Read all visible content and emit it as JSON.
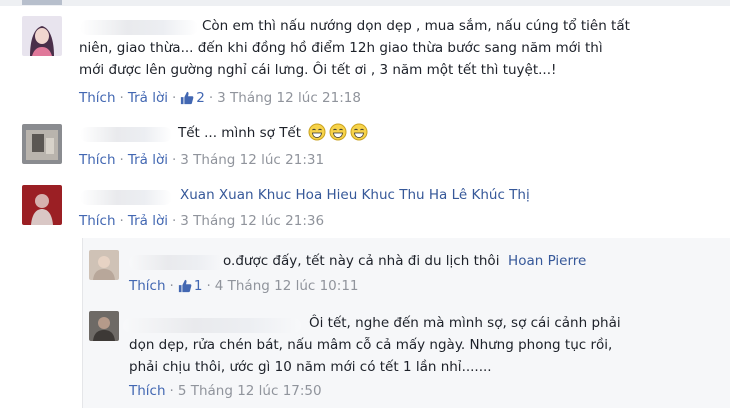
{
  "comments": [
    {
      "line1": "Còn em thì nấu nướng dọn dẹp , mua sắm, nấu cúng tổ tiên tất",
      "line2": "niên, giao thừa... đến khi đồng hồ điểm 12h giao thừa bước sang năm mới thì",
      "line3": "mới được lên gường nghỉ cái lưng. Ôi tết ơi , 3 năm một tết thì tuyệt...!",
      "like_label": "Thích",
      "reply_label": "Trả lời",
      "like_count": "2",
      "timestamp": "3 Tháng 12 lúc 21:18"
    },
    {
      "line1": "Tết ... mình sợ Tết",
      "emoji_icons": [
        "grinning-sweat-face-icon",
        "grinning-sweat-face-icon",
        "grinning-sweat-face-icon"
      ],
      "like_label": "Thích",
      "reply_label": "Trả lời",
      "timestamp": "3 Tháng 12 lúc 21:31"
    },
    {
      "tagged": "Xuan Xuan Khuc Hoa Hieu Khuc Thu Ha Lê Khúc Thị",
      "like_label": "Thích",
      "reply_label": "Trả lời",
      "timestamp": "3 Tháng 12 lúc 21:36"
    }
  ],
  "replies": [
    {
      "text": "o.được đấy, tết này cả nhà đi du lịch thôi",
      "tagged": "Hoan Pierre",
      "like_label": "Thích",
      "like_count": "1",
      "timestamp": "4 Tháng 12 lúc 10:11"
    },
    {
      "line1": "Ôi tết, nghe đến mà mình sợ, sợ cái cảnh phải",
      "line2": "dọn dẹp, rửa chén bát, nấu mâm cỗ cả mấy ngày. Nhưng phong tục rồi,",
      "line3": "phải chịu thôi, ước gì 10 năm mới có tết 1 lần nhỉ.......",
      "like_label": "Thích",
      "timestamp": "5 Tháng 12 lúc 17:50"
    }
  ],
  "colors": {
    "link": "#365899",
    "action": "#4267b2",
    "meta": "#90949c",
    "text": "#1d2129",
    "reply_bg": "#f6f7f9"
  }
}
